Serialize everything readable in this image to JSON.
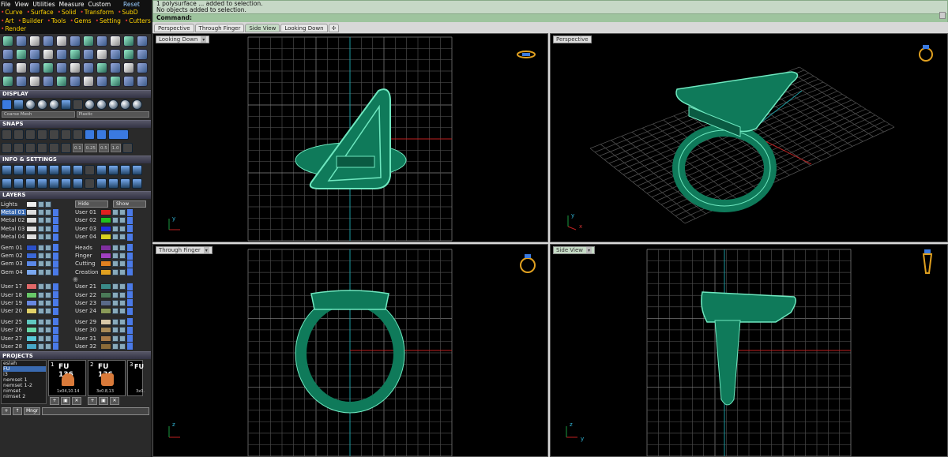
{
  "menu": [
    "File",
    "View",
    "Utilities",
    "Measure",
    "Custom"
  ],
  "reset_label": "Reset",
  "modes": [
    "Curve",
    "Surface",
    "Solid",
    "Transform",
    "SubD",
    "Art",
    "Builder",
    "Tools",
    "Gems",
    "Setting",
    "Cutters",
    "Render"
  ],
  "sections": {
    "display": "DISPLAY",
    "snaps": "SNAPS",
    "info": "INFO & SETTINGS",
    "layers": "LAYERS",
    "projects": "PROJECTS"
  },
  "display_selects": {
    "mesh": "Coarse Mesh",
    "material": "Plastic"
  },
  "snap_values": [
    "0.1",
    "0.25",
    "0.5",
    "1.0"
  ],
  "layers": {
    "lights": "Lights",
    "hide": "Hide",
    "show": "Show",
    "groups": [
      [
        {
          "left": "Metal 01",
          "lc": "#dddddd",
          "right": "User 01",
          "rc": "#e02020"
        },
        {
          "left": "Metal 02",
          "lc": "#dddddd",
          "right": "User 02",
          "rc": "#20c020"
        },
        {
          "left": "Metal 03",
          "lc": "#dddddd",
          "right": "User 03",
          "rc": "#2030e0"
        },
        {
          "left": "Metal 04",
          "lc": "#dddddd",
          "right": "User 04",
          "rc": "#d8d020"
        }
      ],
      [
        {
          "left": "Gem 01",
          "lc": "#2a50c8",
          "right": "Heads",
          "rc": "#8030a0"
        },
        {
          "left": "Gem 02",
          "lc": "#3a68d8",
          "right": "Finger",
          "rc": "#a040c0"
        },
        {
          "left": "Gem 03",
          "lc": "#5a88e8",
          "right": "Cutting",
          "rc": "#e08020"
        },
        {
          "left": "Gem 04",
          "lc": "#7aa8f0",
          "right": "Creation",
          "rc": "#e0a020"
        }
      ],
      [
        {
          "left": "User 17",
          "lc": "#e06868",
          "right": "User 21",
          "rc": "#3a8a88"
        },
        {
          "left": "User 18",
          "lc": "#68c868",
          "right": "User 22",
          "rc": "#4a7a58"
        },
        {
          "left": "User 19",
          "lc": "#6888e0",
          "right": "User 23",
          "rc": "#5a6a88"
        },
        {
          "left": "User 20",
          "lc": "#e0d068",
          "right": "User 24",
          "rc": "#8a9a58"
        }
      ],
      [
        {
          "left": "User 25",
          "lc": "#60c8c0",
          "right": "User 29",
          "rc": "#d8c8a8"
        },
        {
          "left": "User 26",
          "lc": "#68d8a8",
          "right": "User 30",
          "rc": "#a88a58"
        },
        {
          "left": "User 27",
          "lc": "#58c8d8",
          "right": "User 31",
          "rc": "#a87a48"
        },
        {
          "left": "User 28",
          "lc": "#48a8c8",
          "right": "User 32",
          "rc": "#8a6a38"
        }
      ]
    ]
  },
  "projects": {
    "list": [
      "eslah",
      "FU",
      "i3",
      "nemset 1",
      "nemset 1-2",
      "nimset",
      "nimset 2"
    ],
    "thumbs": [
      {
        "num": "1",
        "title": "FU 136",
        "sub": "1x04,10.14"
      },
      {
        "num": "2",
        "title": "FU 136",
        "sub": "3x0.8,13"
      },
      {
        "num": "3",
        "title": "FU",
        "sub": "3x0."
      }
    ],
    "mngr": "Mngr"
  },
  "command": {
    "line1": "1 polysurface ... added to selection.",
    "line2": "No objects added to selection.",
    "prompt": "Command:"
  },
  "tabs": [
    "Perspective",
    "Through Finger",
    "Side View",
    "Looking Down",
    "✢"
  ],
  "viewports": {
    "top_left": "Looking Down",
    "top_right": "Perspective",
    "bottom_left": "Through Finger",
    "bottom_right": "Side View",
    "axis_y": "y",
    "axis_x": "x",
    "axis_z": "z"
  },
  "colors": {
    "ring": "#0f7a5a",
    "ring_highlight": "#6fe8c0",
    "grid": "#5a5a5a",
    "axis_red": "#c02020",
    "axis_teal": "#1a9aa0"
  }
}
